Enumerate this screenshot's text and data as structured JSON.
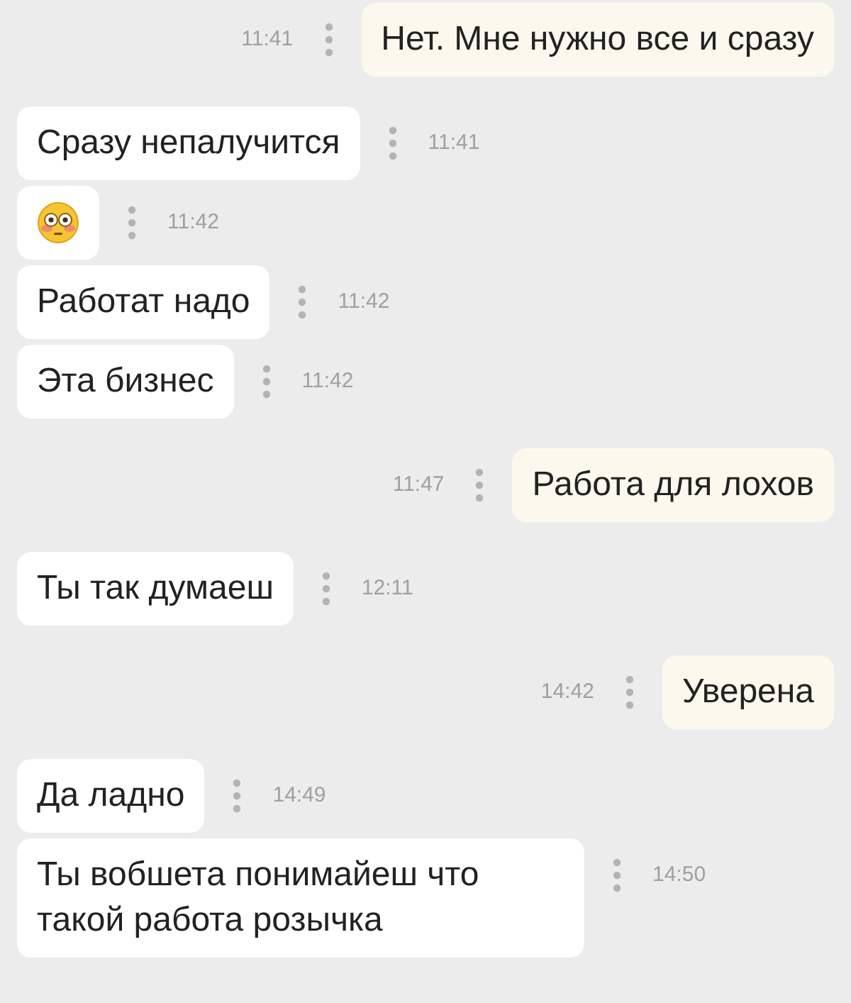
{
  "messages": [
    {
      "outgoing": true,
      "kind": "text",
      "text": "Нет. Мне нужно все и сразу",
      "time": "11:41"
    },
    {
      "outgoing": false,
      "kind": "text",
      "text": "Сразу непалучится",
      "time": "11:41"
    },
    {
      "outgoing": false,
      "kind": "emoji",
      "time": "11:42"
    },
    {
      "outgoing": false,
      "kind": "text",
      "text": "Работат надо",
      "time": "11:42"
    },
    {
      "outgoing": false,
      "kind": "text",
      "text": "Эта бизнес",
      "time": "11:42"
    },
    {
      "outgoing": true,
      "kind": "text",
      "text": "Работа для лохов",
      "time": "11:47"
    },
    {
      "outgoing": false,
      "kind": "text",
      "text": "Ты так думаеш",
      "time": "12:11"
    },
    {
      "outgoing": true,
      "kind": "text",
      "text": "Уверена",
      "time": "14:42"
    },
    {
      "outgoing": false,
      "kind": "text",
      "text": "Да ладно",
      "time": "14:49"
    },
    {
      "outgoing": false,
      "kind": "text",
      "text": "Ты вобшета понимайеш что такой работа розычка",
      "time": "14:50"
    }
  ]
}
